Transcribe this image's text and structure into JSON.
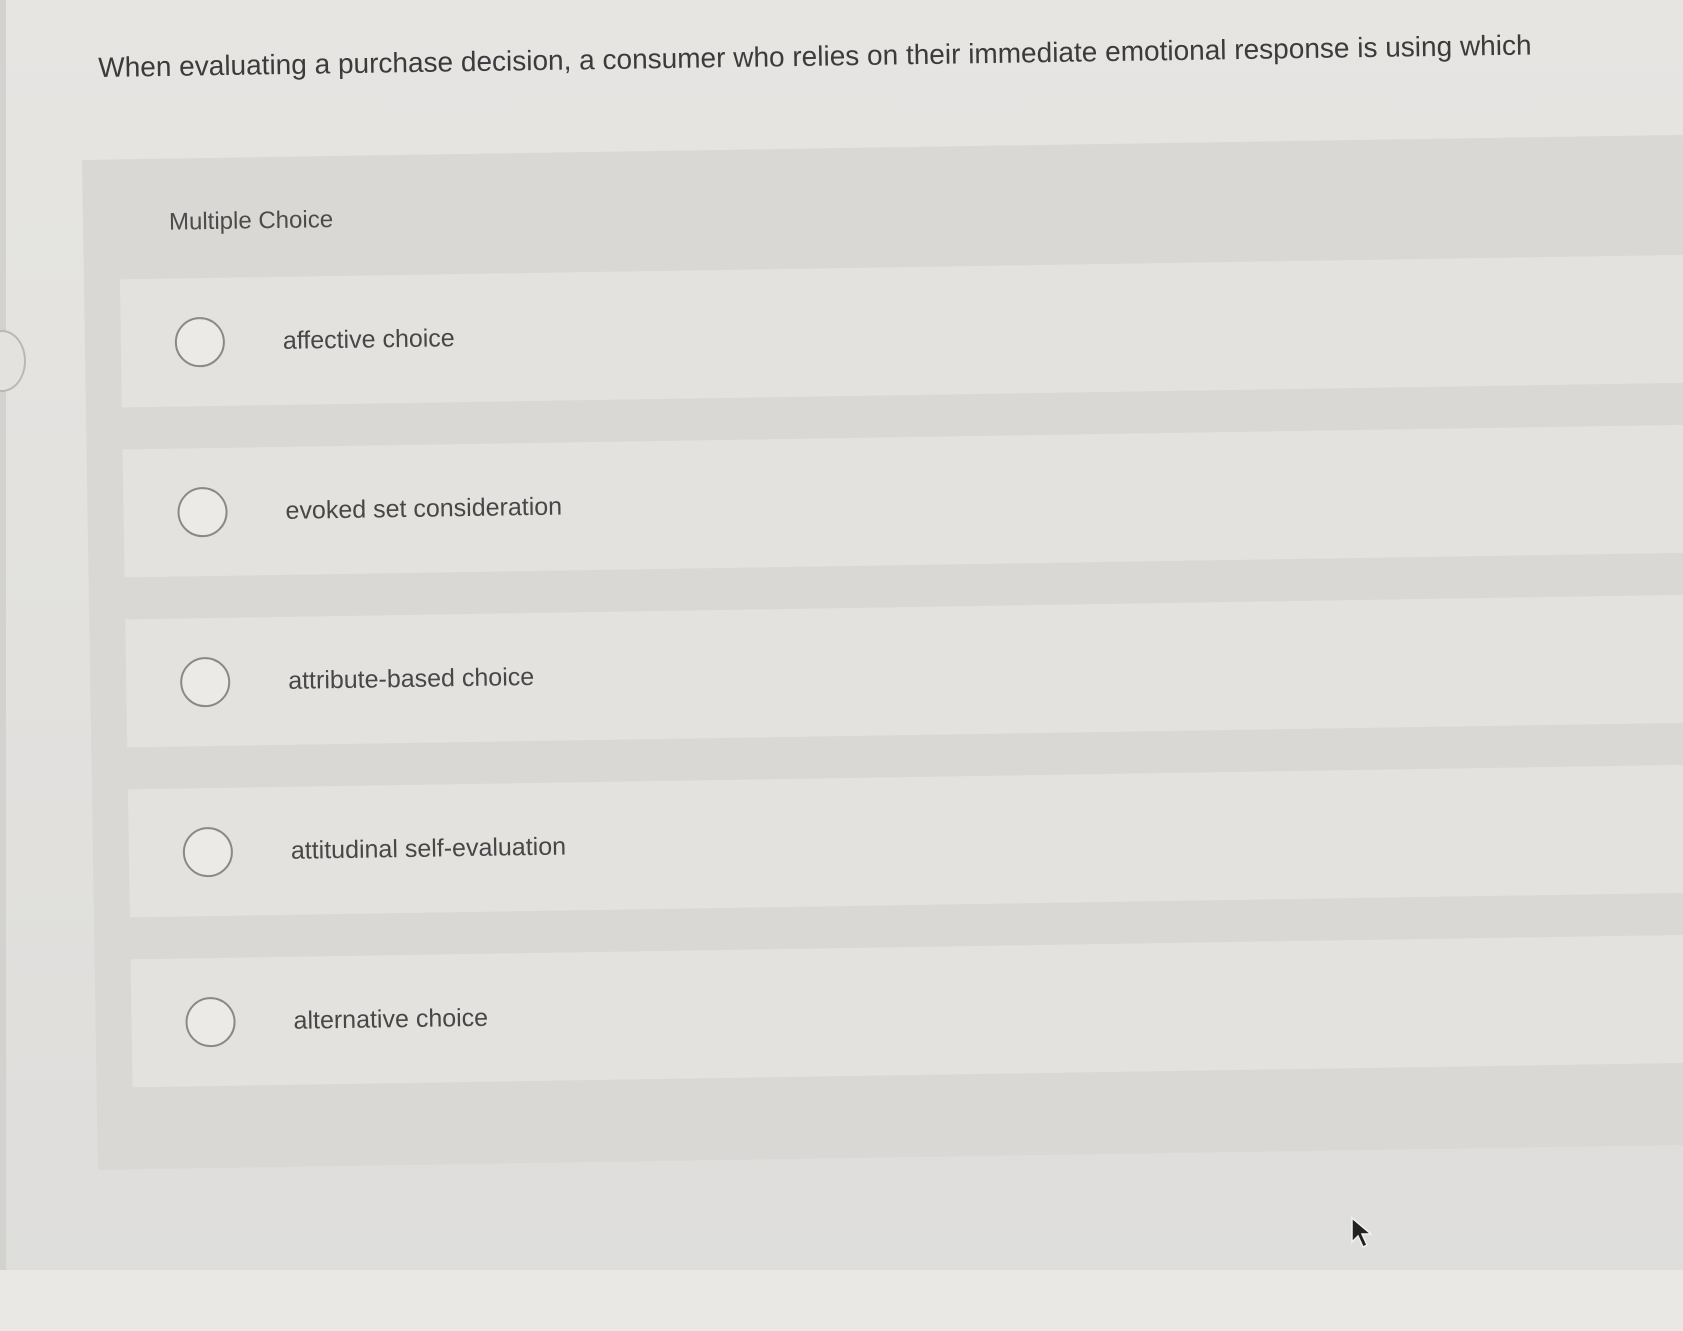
{
  "question": {
    "text": "When evaluating a purchase decision, a consumer who relies on their immediate emotional response is using which"
  },
  "section": {
    "type_label": "Multiple Choice"
  },
  "options": [
    {
      "label": "affective choice",
      "selected": false
    },
    {
      "label": "evoked set consideration",
      "selected": false
    },
    {
      "label": "attribute-based choice",
      "selected": false
    },
    {
      "label": "attitudinal self-evaluation",
      "selected": false
    },
    {
      "label": "alternative choice",
      "selected": false
    }
  ],
  "icons": {
    "radio": "radio-unselected-icon",
    "pointer": "mouse-pointer-icon"
  }
}
